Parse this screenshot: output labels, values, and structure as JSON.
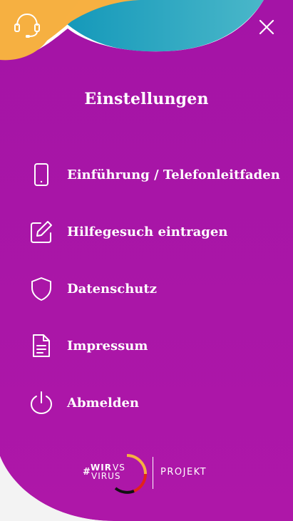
{
  "menu": {
    "title": "Einstellungen",
    "items": [
      {
        "label": "Einführung / Telefonleitfaden",
        "icon": "phone-icon"
      },
      {
        "label": "Hilfegesuch eintragen",
        "icon": "edit-icon"
      },
      {
        "label": "Datenschutz",
        "icon": "shield-icon"
      },
      {
        "label": "Impressum",
        "icon": "document-icon"
      },
      {
        "label": "Abmelden",
        "icon": "power-icon"
      }
    ]
  },
  "footer": {
    "hash": "#",
    "wir": "WIR",
    "vs": "VS",
    "virus": "VIRUS",
    "projekt": "PROJEKT"
  },
  "colors": {
    "panel": "#a814a8",
    "accent_orange": "#f6b041",
    "accent_teal": "#15a2c0",
    "text": "#ffffff"
  }
}
